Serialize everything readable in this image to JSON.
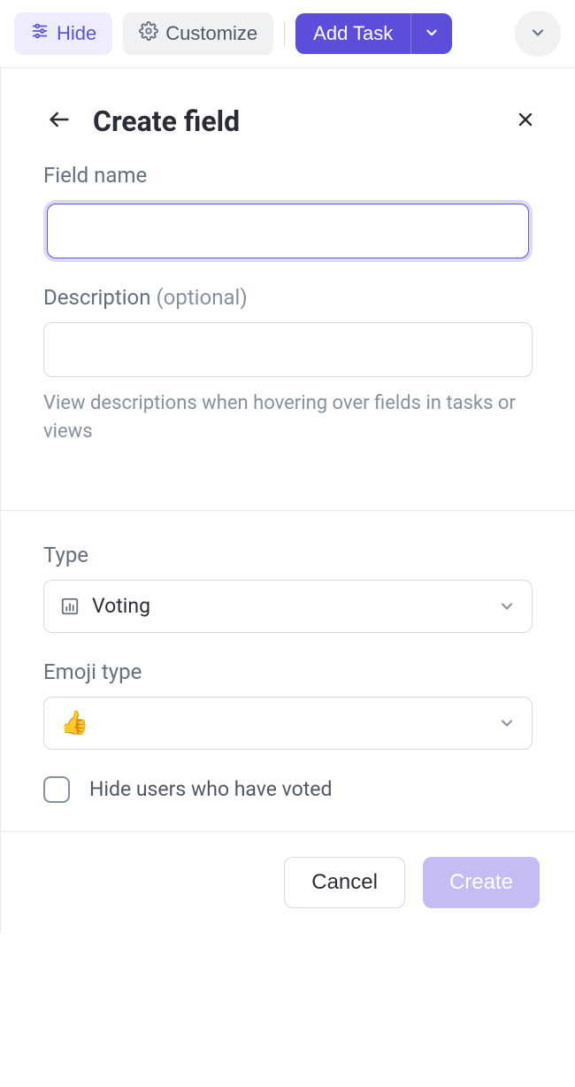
{
  "toolbar": {
    "hide_label": "Hide",
    "customize_label": "Customize",
    "add_task_label": "Add Task"
  },
  "panel": {
    "title": "Create field"
  },
  "form": {
    "field_name_label": "Field name",
    "field_name_value": "",
    "description_label": "Description ",
    "description_suffix": "(optional)",
    "description_value": "",
    "description_helper": "View descriptions when hovering over fields in tasks or views"
  },
  "type_section": {
    "type_label": "Type",
    "type_value": "Voting",
    "emoji_type_label": "Emoji type",
    "emoji_value": "👍",
    "hide_users_label": "Hide users who have voted",
    "hide_users_checked": false
  },
  "footer": {
    "cancel_label": "Cancel",
    "create_label": "Create"
  },
  "colors": {
    "accent": "#5c4ddb",
    "border": "#d8d9dd",
    "muted": "#87909e"
  }
}
